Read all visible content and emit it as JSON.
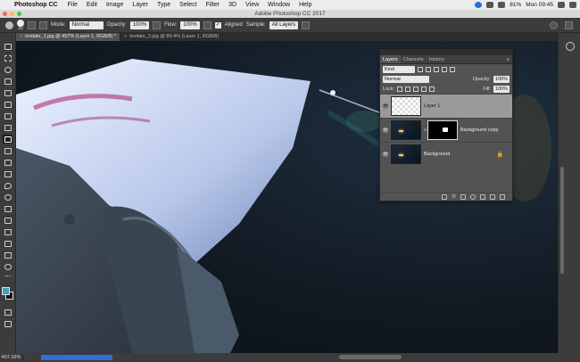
{
  "menubar": {
    "app": "Photoshop CC",
    "menus": [
      "File",
      "Edit",
      "Image",
      "Layer",
      "Type",
      "Select",
      "Filter",
      "3D",
      "View",
      "Window",
      "Help"
    ],
    "battery": "81%",
    "clock": "Mon 09:45",
    "icons": [
      "apple-logo",
      "dropbox-icon",
      "wifi-icon",
      "battery-icon",
      "search-icon",
      "menu-icon"
    ]
  },
  "window": {
    "title": "Adobe Photoshop CC 2017"
  },
  "options": {
    "brush_size": "30",
    "mode_label": "Mode:",
    "mode_value": "Normal",
    "opacity_label": "Opacity:",
    "opacity_value": "100%",
    "flow_label": "Flow:",
    "flow_value": "100%",
    "aligned_label": "Aligned",
    "sample_label": "Sample:",
    "sample_value": "All Layers"
  },
  "tabs": [
    {
      "label": "levitate_1.jpg @ 457% (Layer 1, RGB/8) *",
      "active": true
    },
    {
      "label": "levitate_2.jpg @ 89.4% (Layer 1, RGB/8)",
      "active": false
    }
  ],
  "panel": {
    "tabs": [
      "Layers",
      "Channels",
      "History"
    ],
    "kind_value": "Kind",
    "blend_value": "Normal",
    "opacity_label": "Opacity:",
    "opacity_value": "100%",
    "lock_label": "Lock:",
    "fill_label": "Fill:",
    "fill_value": "100%",
    "layers": [
      {
        "name": "Layer 1",
        "selected": true
      },
      {
        "name": "Background copy",
        "selected": false
      },
      {
        "name": "Background",
        "selected": false
      }
    ],
    "footer_fx": "fx"
  },
  "status": {
    "zoom": "457.16%"
  },
  "colors": {
    "accent": "#2f6fd6",
    "foreground_swatch": "#3aa3b0",
    "background_swatch": "#111111"
  }
}
